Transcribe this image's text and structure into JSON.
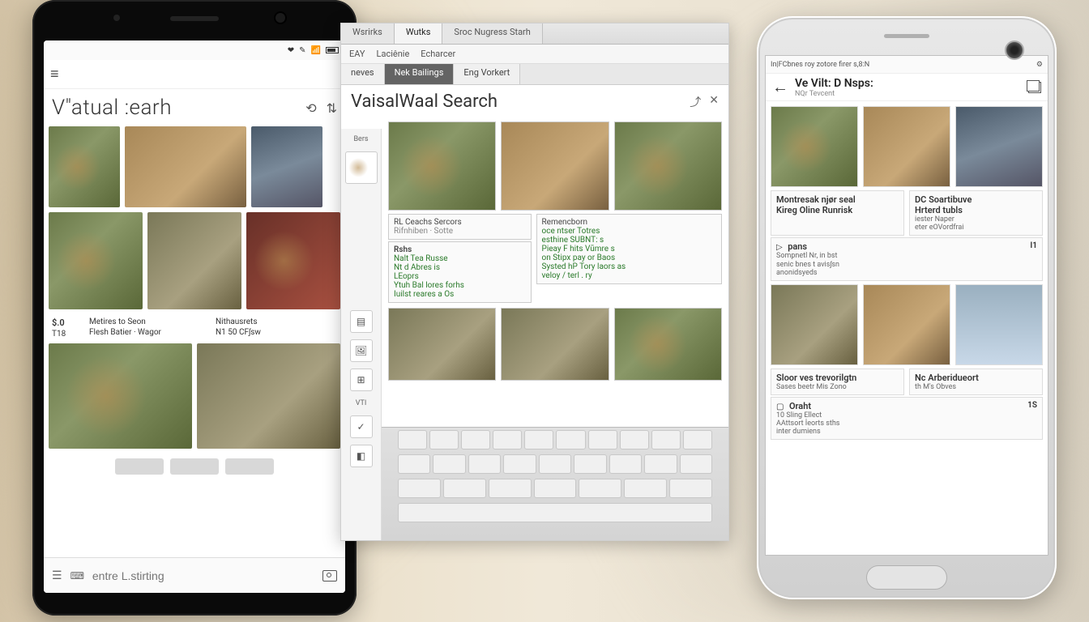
{
  "phone1": {
    "title": "V\"atual :earh",
    "back_icon": "menu-icon",
    "header_actions": [
      "refresh",
      "filter"
    ],
    "row1_labels": [
      "",
      "",
      ""
    ],
    "caption_block": {
      "left_num": "$.0",
      "left_sub": "T18",
      "mid_title": "Metires to Seon",
      "mid_sub": "Flesh Batier · Wagor",
      "right_title": "Nithausrets",
      "right_sub": "N1 50   CFʃsw"
    },
    "footer_placeholder": "entre L.stirting"
  },
  "desktop": {
    "tabs": [
      "Wsrirks",
      "Wutks",
      "Sroc Nugress Starh"
    ],
    "menu": [
      "EAY",
      "Laciênie",
      "Echarcer"
    ],
    "crumbs": [
      "neves",
      "Nek Bailings",
      "Eng Vorkert"
    ],
    "title": "VaisalWaal Search",
    "title_icons": [
      "share",
      "close"
    ],
    "side_label_top": "Bers",
    "side_label_mid": "VTI",
    "info1": {
      "t1": "RL Ceachs Sercors",
      "t2": "Rifnhiben · Sotte"
    },
    "info2": {
      "t1": "Remencborn",
      "t2": "oce ntser Totres",
      "t3": "esthine SUBNT: s",
      "t4": "Pieay F hits   Vūmre s",
      "t5": "on Stipx pay or Baos",
      "t6": "Systed hP Tory laors as",
      "t7": " veloy / terl . ry"
    },
    "info3": {
      "h": "Rshs",
      "l1": "Nalt Tea Russe",
      "l2": "Nt d Abres is",
      "l3": "LEoprs",
      "l4": "Ytuh Bal lores forhs",
      "l5": "Iuilst reares a Os"
    }
  },
  "phone2": {
    "status": "In|FCbnes roy zotore firer s,8:N",
    "title": "Ve Vilt: D Nsps:",
    "subtitle": "NQr   Tevcent",
    "card1": {
      "h1": "Montresak njør seal",
      "h2": "Kireg Oline Runrisk"
    },
    "card1r": {
      "h1": "DC Soartibuve",
      "h2": "Hrterd tubls",
      "h3": "iester Naper",
      "h4": "eter eOVordfrai"
    },
    "card2": {
      "h": "pans",
      "l1": "Sompnetl  Nr, in bst",
      "l2": "senic bnes t avisʃsn",
      "l3": "anonidsyeds",
      "badge": "I1"
    },
    "card3": {
      "h1": "Sloor ves trevorilgtn",
      "h2": "Sases beetr Mis Zono"
    },
    "card3r": {
      "h1": "Nc Arberidueort",
      "h2": "th M's Obves"
    },
    "card4": {
      "h": "Oraht",
      "l1": "10 Sling Ellect",
      "l2": "AAttsort İeorts sths",
      "l3": "inter dumiens",
      "badge": "1S"
    }
  }
}
